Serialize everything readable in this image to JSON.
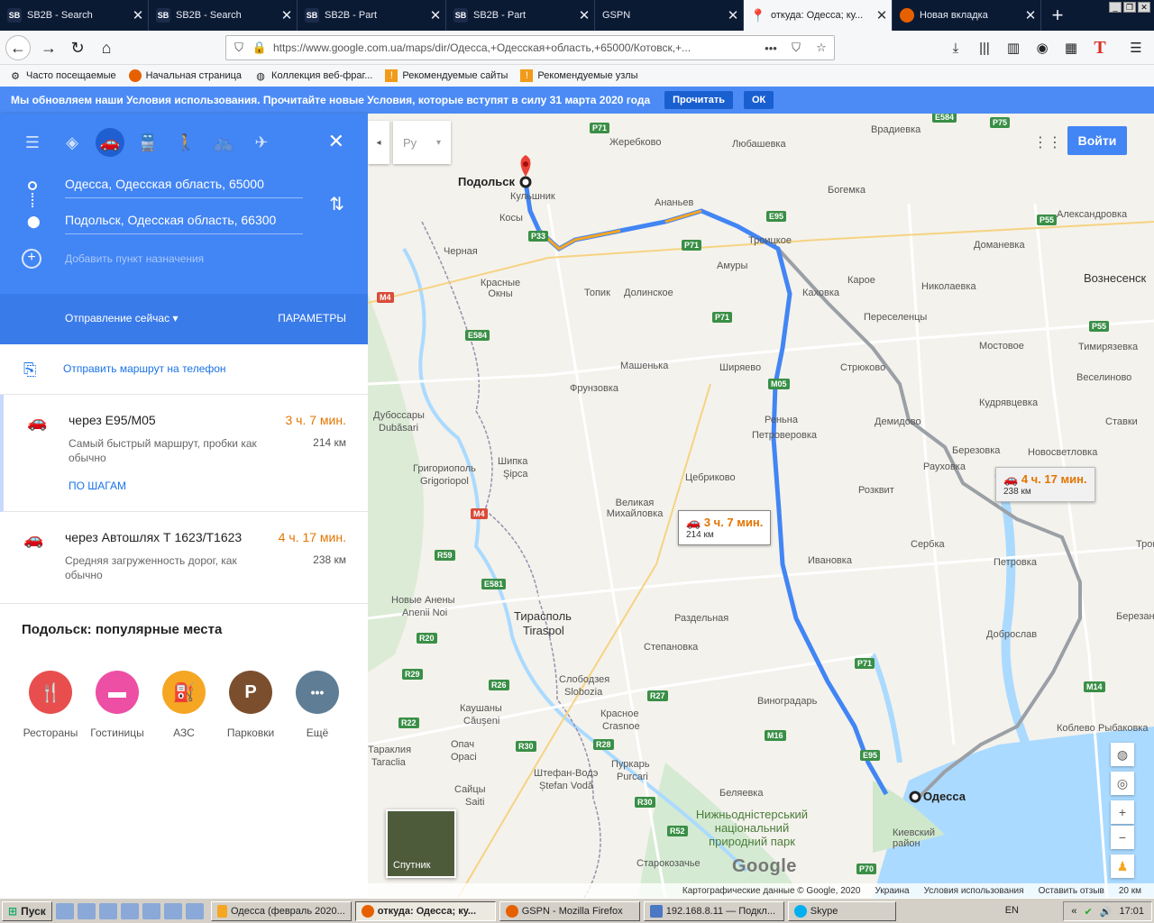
{
  "tabs": [
    {
      "title": "SB2B - Search",
      "icon": "sb2b-icon"
    },
    {
      "title": "SB2B - Search",
      "icon": "sb2b-icon"
    },
    {
      "title": "SB2B - Part",
      "icon": "sb2b-icon"
    },
    {
      "title": "SB2B - Part",
      "icon": "sb2b-icon"
    },
    {
      "title": "GSPN",
      "icon": "none"
    },
    {
      "title": "откуда: Одесса; ку...",
      "icon": "maps-pin-icon"
    },
    {
      "title": "Новая вкладка",
      "icon": "firefox-icon"
    }
  ],
  "url": "https://www.google.com.ua/maps/dir/Одесса,+Одесская+область,+65000/Котовск,+...",
  "bookmarks": [
    {
      "label": "Часто посещаемые",
      "icon": "gear-icon"
    },
    {
      "label": "Начальная страница",
      "icon": "firefox-icon"
    },
    {
      "label": "Коллекция веб-фраг...",
      "icon": "globe-icon"
    },
    {
      "label": "Рекомендуемые сайты",
      "icon": "feed-icon"
    },
    {
      "label": "Рекомендуемые узлы",
      "icon": "feed-icon"
    }
  ],
  "notice": {
    "text": "Мы обновляем наши Условия использования. Прочитайте новые Условия, которые вступят в силу 31 марта 2020 года",
    "read": "Прочитать",
    "ok": "ОК"
  },
  "directions": {
    "origin": "Одесса, Одесская область, 65000",
    "destination": "Подольск, Одесская область, 66300",
    "add_stop": "Добавить пункт назначения",
    "depart": "Отправление сейчас",
    "params": "ПАРАМЕТРЫ",
    "send_phone": "Отправить маршрут на телефон"
  },
  "routes": [
    {
      "via": "через Е95/М05",
      "duration": "3 ч. 7 мин.",
      "distance": "214 км",
      "desc": "Самый быстрый маршрут, пробки как обычно",
      "steps": "ПО ШАГАМ"
    },
    {
      "via": "через Автошлях Т 1623/Т1623",
      "duration": "4 ч. 17 мин.",
      "distance": "238 км",
      "desc": "Средняя загруженность дорог, как обычно"
    }
  ],
  "popular": {
    "title": "Подольск: популярные места",
    "categories": [
      {
        "label": "Рестораны",
        "color": "#e94e4e",
        "glyph": "🍴"
      },
      {
        "label": "Гостиницы",
        "color": "#ec4fa3",
        "glyph": "▬"
      },
      {
        "label": "АЗС",
        "color": "#f5a623",
        "glyph": "⛽"
      },
      {
        "label": "Парковки",
        "color": "#7b4f2e",
        "glyph": "P"
      },
      {
        "label": "Ещё",
        "color": "#5f7d95",
        "glyph": "•••"
      }
    ]
  },
  "map": {
    "signin": "Войти",
    "layer": "Ру",
    "satellite": "Спутник",
    "google": "Google",
    "tip_main": {
      "duration": "3 ч. 7 мин.",
      "distance": "214 км"
    },
    "tip_alt": {
      "duration": "4 ч. 17 мин.",
      "distance": "238 км"
    },
    "footer": [
      "Картографические данные © Google, 2020",
      "Украина",
      "Условия использования",
      "Оставить отзыв",
      "20 км"
    ],
    "places": [
      {
        "name": "Подольск",
        "cls": "bold"
      },
      {
        "name": "Одесса",
        "cls": "bold"
      },
      {
        "name": "Тирасполь",
        "cls": "big"
      },
      {
        "name": "Tiraspol",
        "cls": "big"
      },
      {
        "name": "Жеребково",
        "cls": ""
      },
      {
        "name": "Любашевка",
        "cls": ""
      },
      {
        "name": "Врадиевка",
        "cls": ""
      },
      {
        "name": "Богемка",
        "cls": ""
      },
      {
        "name": "Александровка",
        "cls": ""
      },
      {
        "name": "Кульшник",
        "cls": ""
      },
      {
        "name": "Ананьев",
        "cls": ""
      },
      {
        "name": "Косы",
        "cls": ""
      },
      {
        "name": "Троицкое",
        "cls": ""
      },
      {
        "name": "Доманевка",
        "cls": ""
      },
      {
        "name": "Черная",
        "cls": ""
      },
      {
        "name": "Амуры",
        "cls": ""
      },
      {
        "name": "Вознесенск",
        "cls": ""
      },
      {
        "name": "Красные Окны",
        "cls": ""
      },
      {
        "name": "Кароe",
        "cls": ""
      },
      {
        "name": "Каховка",
        "cls": ""
      },
      {
        "name": "Николаевка",
        "cls": ""
      },
      {
        "name": "Топик",
        "cls": ""
      },
      {
        "name": "Долинское",
        "cls": ""
      },
      {
        "name": "Переселенцы",
        "cls": ""
      },
      {
        "name": "Мостовое",
        "cls": ""
      },
      {
        "name": "Тимирязевка",
        "cls": ""
      },
      {
        "name": "Машенька",
        "cls": ""
      },
      {
        "name": "Ширяево",
        "cls": ""
      },
      {
        "name": "Стрюково",
        "cls": ""
      },
      {
        "name": "Веселиново",
        "cls": ""
      },
      {
        "name": "Фрунзовка",
        "cls": ""
      },
      {
        "name": "Кудрявцевка",
        "cls": ""
      },
      {
        "name": "Дубоссары",
        "cls": ""
      },
      {
        "name": "Dubăsari",
        "cls": ""
      },
      {
        "name": "Демидово",
        "cls": ""
      },
      {
        "name": "Ставки",
        "cls": ""
      },
      {
        "name": "Реньна",
        "cls": ""
      },
      {
        "name": "Петроверовка",
        "cls": ""
      },
      {
        "name": "Березовка",
        "cls": ""
      },
      {
        "name": "Новосветловка",
        "cls": ""
      },
      {
        "name": "Григориополь",
        "cls": ""
      },
      {
        "name": "Grigoriopol",
        "cls": ""
      },
      {
        "name": "Шипка",
        "cls": ""
      },
      {
        "name": "Şipca",
        "cls": ""
      },
      {
        "name": "Цебриково",
        "cls": ""
      },
      {
        "name": "Рауховка",
        "cls": ""
      },
      {
        "name": "Розквит",
        "cls": ""
      },
      {
        "name": "Великая Михайловка",
        "cls": ""
      },
      {
        "name": "Сербка",
        "cls": ""
      },
      {
        "name": "Трон",
        "cls": ""
      },
      {
        "name": "Ивановка",
        "cls": ""
      },
      {
        "name": "Петровка",
        "cls": ""
      },
      {
        "name": "Новые Анены",
        "cls": ""
      },
      {
        "name": "Anenii Noi",
        "cls": ""
      },
      {
        "name": "Раздельная",
        "cls": ""
      },
      {
        "name": "Березань",
        "cls": ""
      },
      {
        "name": "Степановка",
        "cls": ""
      },
      {
        "name": "Доброслав",
        "cls": ""
      },
      {
        "name": "Слободзея",
        "cls": ""
      },
      {
        "name": "Slobozia",
        "cls": ""
      },
      {
        "name": "Виноградарь",
        "cls": ""
      },
      {
        "name": "Каушаны",
        "cls": ""
      },
      {
        "name": "Căușeni",
        "cls": ""
      },
      {
        "name": "Красное",
        "cls": ""
      },
      {
        "name": "Crasnoe",
        "cls": ""
      },
      {
        "name": "Коблево",
        "cls": ""
      },
      {
        "name": "Рыбаковка",
        "cls": ""
      },
      {
        "name": "Тараклия",
        "cls": ""
      },
      {
        "name": "Taraclia",
        "cls": ""
      },
      {
        "name": "Опач",
        "cls": ""
      },
      {
        "name": "Opaci",
        "cls": ""
      },
      {
        "name": "Пуркарь",
        "cls": ""
      },
      {
        "name": "Purcari",
        "cls": ""
      },
      {
        "name": "Беляевка",
        "cls": ""
      },
      {
        "name": "Штефан-Водэ",
        "cls": ""
      },
      {
        "name": "Ștefan Vodă",
        "cls": ""
      },
      {
        "name": "Сайцы",
        "cls": ""
      },
      {
        "name": "Saiti",
        "cls": ""
      },
      {
        "name": "Нижньодністерський національний природний парк",
        "cls": "big"
      },
      {
        "name": "Киевский район",
        "cls": ""
      },
      {
        "name": "Старокозачье",
        "cls": ""
      }
    ],
    "shields": [
      "P71",
      "P75",
      "E95",
      "P33",
      "M4",
      "E584",
      "P71",
      "P55",
      "M05",
      "P55",
      "P71",
      "M4",
      "R59",
      "E581",
      "R20",
      "R29",
      "R26",
      "R27",
      "M16",
      "P71",
      "M14",
      "R22",
      "R30",
      "R28",
      "R30",
      "R52",
      "P70",
      "E95",
      "E584"
    ]
  },
  "taskbar": {
    "start": "Пуск",
    "tasks": [
      {
        "label": "Одесса (февраль 2020...",
        "active": false
      },
      {
        "label": "откуда: Одесса; ку...",
        "active": true
      },
      {
        "label": "GSPN - Mozilla Firefox",
        "active": false
      },
      {
        "label": "192.168.8.11 — Подкл...",
        "active": false
      },
      {
        "label": "Skype",
        "active": false
      }
    ],
    "lang": "EN",
    "time": "17:01"
  }
}
